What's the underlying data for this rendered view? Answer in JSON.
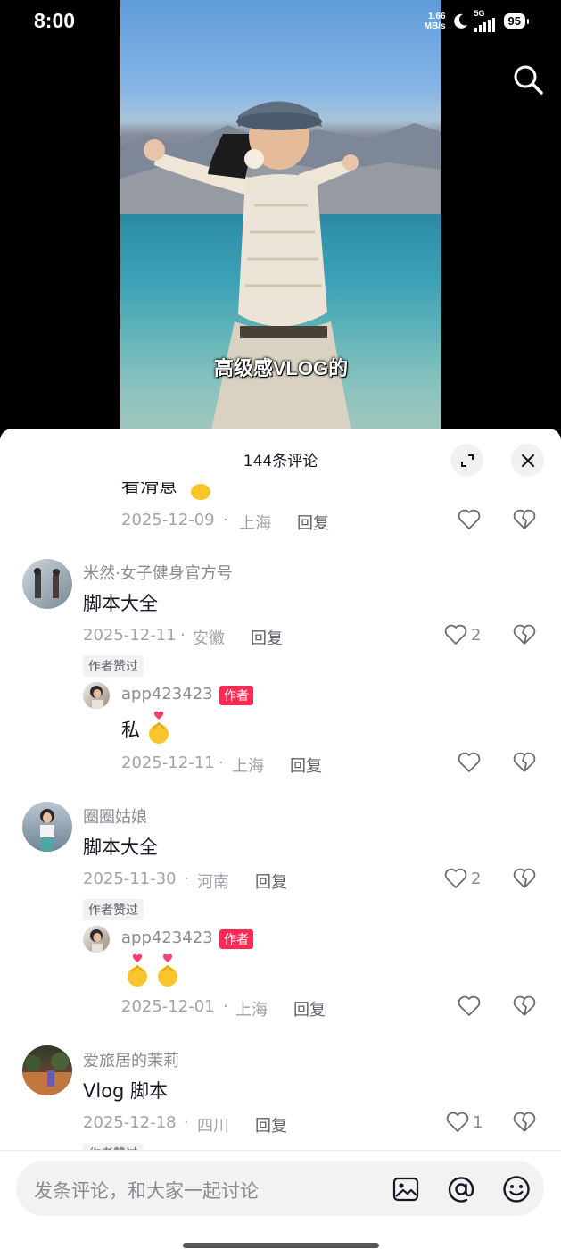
{
  "status_bar": {
    "time": "8:00",
    "speed_value": "1.66",
    "speed_unit": "MB/s",
    "network": "5G",
    "battery": "95"
  },
  "video": {
    "caption": "高级感VLOG的"
  },
  "sheet": {
    "title": "144条评论"
  },
  "comments": [
    {
      "id": "c0",
      "text": "看滑意",
      "date": "2025-12-09",
      "location": "上海",
      "reply_label": "回复"
    },
    {
      "id": "c1",
      "username": "米然·女子健身官方号",
      "text": "脚本大全",
      "date": "2025-12-11",
      "location": "安徽",
      "reply_label": "回复",
      "likes": "2",
      "liked_badge": "作者赞过",
      "sub_reply": {
        "username": "app423423",
        "author_badge": "作者",
        "text": "私",
        "date": "2025-12-11",
        "location": "上海",
        "reply_label": "回复"
      }
    },
    {
      "id": "c2",
      "username": "圈圈姑娘",
      "text": "脚本大全",
      "date": "2025-11-30",
      "location": "河南",
      "reply_label": "回复",
      "likes": "2",
      "liked_badge": "作者赞过",
      "sub_reply": {
        "username": "app423423",
        "author_badge": "作者",
        "date": "2025-12-01",
        "location": "上海",
        "reply_label": "回复"
      }
    },
    {
      "id": "c3",
      "username": "爱旅居的茉莉",
      "text": "Vlog 脚本",
      "date": "2025-12-18",
      "location": "四川",
      "reply_label": "回复",
      "likes": "1",
      "liked_badge": "作者赞过"
    }
  ],
  "input": {
    "placeholder": "发条评论，和大家一起讨论"
  },
  "icons": [
    "search-icon",
    "expand-icon",
    "close-icon",
    "heart-icon",
    "broken-heart-icon",
    "image-icon",
    "at-icon",
    "emoji-icon",
    "finger-heart-emoji"
  ],
  "colors": {
    "author_badge": "#fe2c55",
    "sheet_bg": "#ffffff",
    "muted_text": "#a2a3a8"
  }
}
